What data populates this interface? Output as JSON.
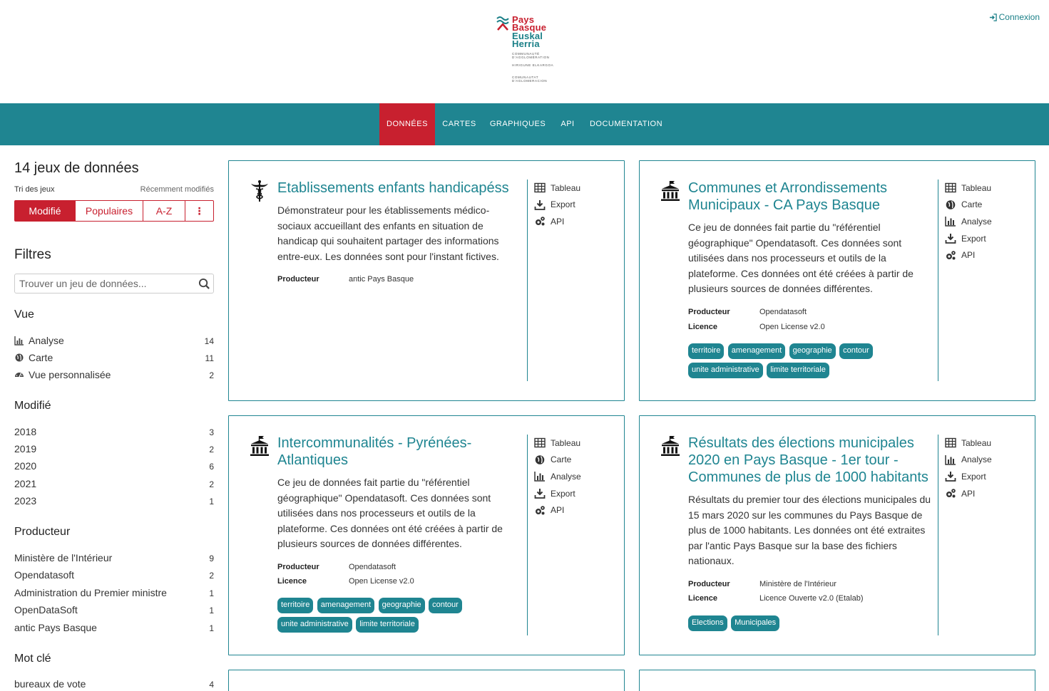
{
  "header": {
    "logo": {
      "line1": "Pays",
      "line2": "Basque",
      "line3": "Euskal",
      "line4": "Herria",
      "sub1": "COMMUNAUTÉ D'AGGLOMÉRATION",
      "sub2": "HIRIGUNE ELKARGOA",
      "sub3": "COMUNAUTAT D'AGLOMERACION"
    },
    "login_label": "Connexion"
  },
  "nav": {
    "items": [
      {
        "label": "DONNÉES",
        "active": true
      },
      {
        "label": "CARTES",
        "active": false
      },
      {
        "label": "GRAPHIQUES",
        "active": false
      },
      {
        "label": "API",
        "active": false
      },
      {
        "label": "DOCUMENTATION",
        "active": false
      }
    ]
  },
  "sidebar": {
    "count_title": "14 jeux de données",
    "sort_label": "Tri des jeux",
    "sort_current": "Récemment modifiés",
    "sort_buttons": [
      "Modifié",
      "Populaires",
      "A-Z",
      "⋮"
    ],
    "filters_title": "Filtres",
    "search_placeholder": "Trouver un jeu de données...",
    "facets": {
      "vue": {
        "title": "Vue",
        "items": [
          {
            "label": "Analyse",
            "count": "14",
            "icon": "bar-chart-icon"
          },
          {
            "label": "Carte",
            "count": "11",
            "icon": "globe-icon"
          },
          {
            "label": "Vue personnalisée",
            "count": "2",
            "icon": "dashboard-icon"
          }
        ]
      },
      "modifie": {
        "title": "Modifié",
        "items": [
          {
            "label": "2018",
            "count": "3"
          },
          {
            "label": "2019",
            "count": "2"
          },
          {
            "label": "2020",
            "count": "6"
          },
          {
            "label": "2021",
            "count": "2"
          },
          {
            "label": "2023",
            "count": "1"
          }
        ]
      },
      "producteur": {
        "title": "Producteur",
        "items": [
          {
            "label": "Ministère de l'Intérieur",
            "count": "9"
          },
          {
            "label": "Opendatasoft",
            "count": "2"
          },
          {
            "label": "Administration du Premier ministre",
            "count": "1"
          },
          {
            "label": "OpenDataSoft",
            "count": "1"
          },
          {
            "label": "antic Pays Basque",
            "count": "1"
          }
        ]
      },
      "motcle": {
        "title": "Mot clé",
        "items": [
          {
            "label": "bureaux de vote",
            "count": "4"
          }
        ]
      }
    }
  },
  "cards": [
    {
      "icon": "caduceus-icon",
      "title": "Etablissements enfants handicapéss",
      "description": "Démonstrateur pour les établissements médico-sociaux accueillant des enfants en situation de handicap qui souhaitent partager des informations entre-eux. Les données sont pour l'instant fictives.",
      "meta": [
        {
          "label": "Producteur",
          "value": "antic Pays Basque"
        }
      ],
      "tags": [],
      "actions": [
        "Tableau",
        "Export",
        "API"
      ]
    },
    {
      "icon": "government-building-icon",
      "title": "Communes et Arrondissements Municipaux - CA Pays Basque",
      "description": "Ce jeu de données fait partie du \"référentiel géographique\" Opendatasoft. Ces données sont utilisées dans nos processeurs et outils de la plateforme. Ces données ont été créées à partir de plusieurs sources de données différentes.",
      "meta": [
        {
          "label": "Producteur",
          "value": "Opendatasoft"
        },
        {
          "label": "Licence",
          "value": "Open License v2.0"
        }
      ],
      "tags": [
        "territoire",
        "amenagement",
        "geographie",
        "contour",
        "unite administrative",
        "limite territoriale"
      ],
      "actions": [
        "Tableau",
        "Carte",
        "Analyse",
        "Export",
        "API"
      ]
    },
    {
      "icon": "government-building-icon",
      "title": "Intercommunalités - Pyrénées-Atlantiques",
      "description": "Ce jeu de données fait partie du \"référentiel géographique\" Opendatasoft. Ces données sont utilisées dans nos processeurs et outils de la plateforme. Ces données ont été créées à partir de plusieurs sources de données différentes.",
      "meta": [
        {
          "label": "Producteur",
          "value": "Opendatasoft"
        },
        {
          "label": "Licence",
          "value": "Open License v2.0"
        }
      ],
      "tags": [
        "territoire",
        "amenagement",
        "geographie",
        "contour",
        "unite administrative",
        "limite territoriale"
      ],
      "actions": [
        "Tableau",
        "Carte",
        "Analyse",
        "Export",
        "API"
      ]
    },
    {
      "icon": "government-building-icon",
      "title": "Résultats des élections municipales 2020 en Pays Basque - 1er tour - Communes de plus de 1000 habitants",
      "description": "Résultats du premier tour des élections municipales du 15 mars 2020 sur les communes du Pays Basque de plus de 1000 habitants. Les données ont été extraites par l'antic Pays Basque sur la base des fichiers nationaux.",
      "meta": [
        {
          "label": "Producteur",
          "value": "Ministère de l'Intérieur"
        },
        {
          "label": "Licence",
          "value": "Licence Ouverte v2.0 (Etalab)"
        }
      ],
      "tags": [
        "Elections",
        "Municipales"
      ],
      "actions": [
        "Tableau",
        "Analyse",
        "Export",
        "API"
      ]
    }
  ],
  "colors": {
    "teal": "#1f8591",
    "red": "#c8202f"
  }
}
